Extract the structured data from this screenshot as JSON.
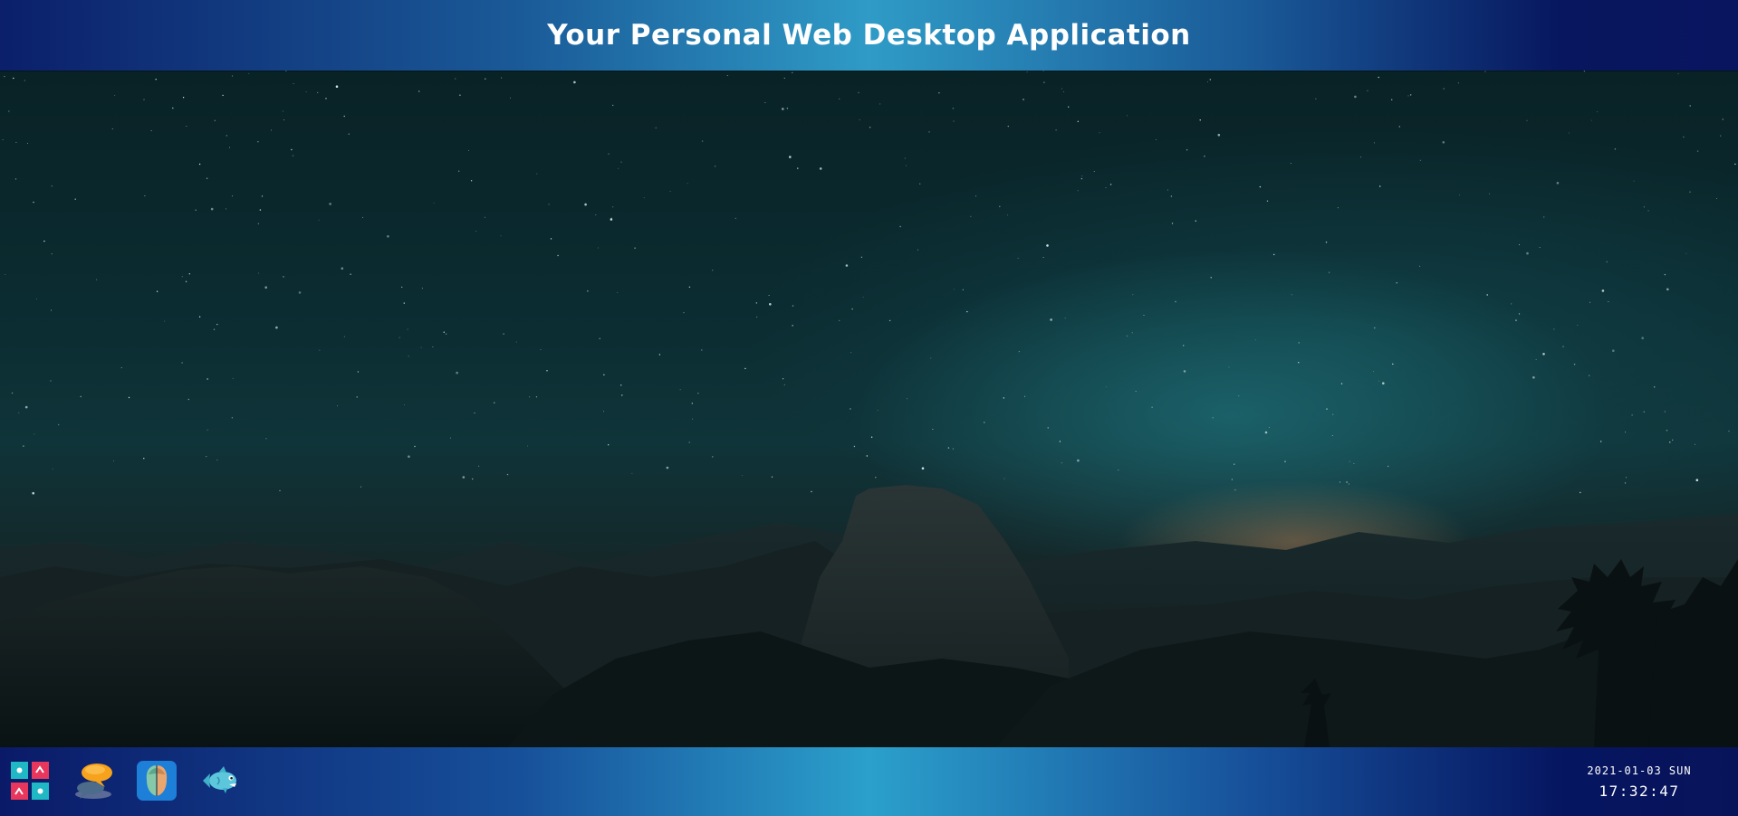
{
  "header": {
    "title": "Your Personal Web Desktop Application"
  },
  "desktop": {
    "wallpaper": "night-sky-mountain-landscape"
  },
  "taskbar": {
    "apps": [
      {
        "icon": "memory-game-icon"
      },
      {
        "icon": "chat-bubbles-icon"
      },
      {
        "icon": "face-profile-icon"
      },
      {
        "icon": "fish-icon"
      }
    ],
    "clock": {
      "date": "2021-01-03 SUN",
      "time": "17:32:47"
    }
  },
  "colors": {
    "bar_dark": "#0a1560",
    "bar_light": "#2f9bc6",
    "sky_dark": "#092226",
    "title_text": "#ffffff"
  }
}
